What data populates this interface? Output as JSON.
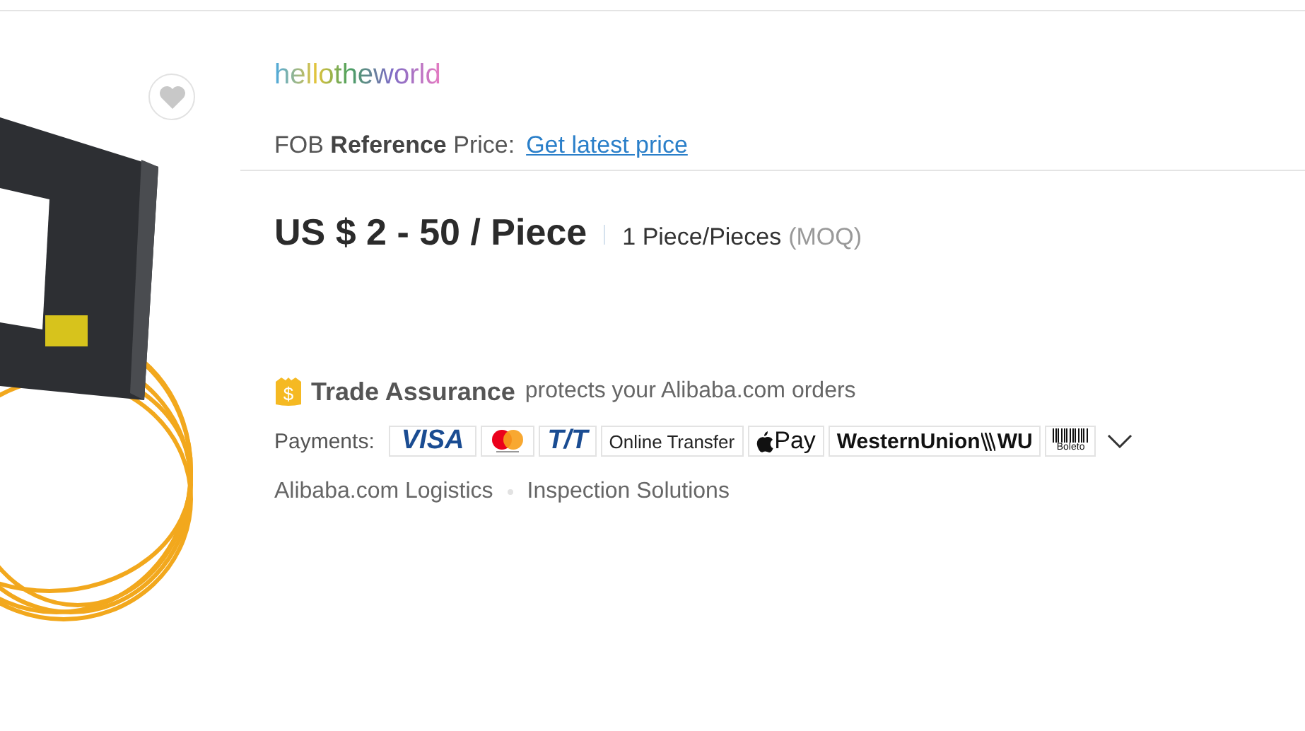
{
  "store_name": "hellotheworld",
  "reference_price": {
    "prefix": "FOB **Reference** Price:",
    "link": "Get latest price"
  },
  "price": {
    "range": "US $ 2 - 50 / Piece",
    "moq": "1 Piece/Pieces",
    "moq_note": "(MOQ)"
  },
  "trade_assurance": {
    "badge": "$",
    "title": "Trade Assurance",
    "text": "protects your Alibaba.com orders"
  },
  "payments": {
    "label": "Payments:",
    "methods": [
      {
        "kind": "visa",
        "label": "VISA"
      },
      {
        "kind": "mastercard"
      },
      {
        "kind": "tt",
        "label": "T/T"
      },
      {
        "kind": "text",
        "label": "Online Transfer"
      },
      {
        "kind": "applepay",
        "label": "Pay"
      },
      {
        "kind": "westernunion",
        "label": "WesternUnion",
        "mark": "WU"
      },
      {
        "kind": "boleto",
        "label": "Boleto"
      }
    ]
  },
  "services": [
    "Alibaba.com Logistics",
    "Inspection Solutions"
  ]
}
